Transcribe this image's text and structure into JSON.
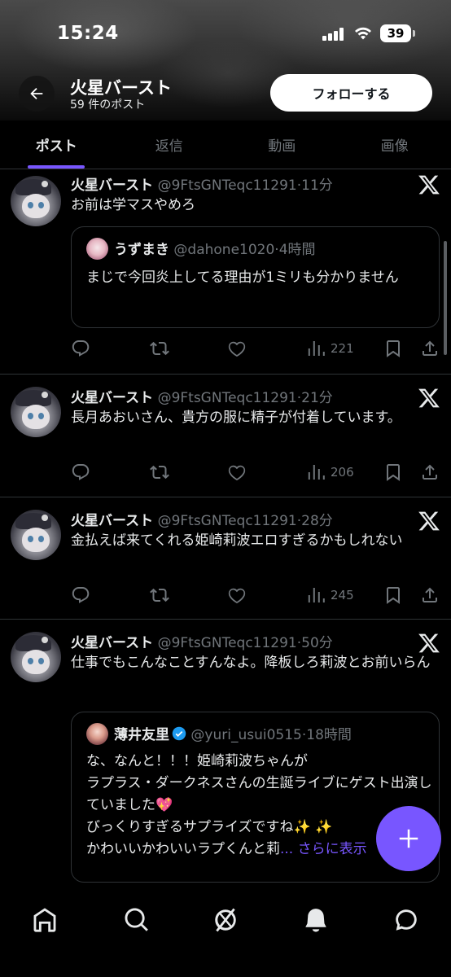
{
  "status_bar": {
    "time": "15:24",
    "battery": "39"
  },
  "header": {
    "profile_name": "火星バースト",
    "post_count": "59 件のポスト",
    "follow_label": "フォローする"
  },
  "tabs": [
    {
      "label": "ポスト",
      "active": true
    },
    {
      "label": "返信",
      "active": false
    },
    {
      "label": "動画",
      "active": false
    },
    {
      "label": "画像",
      "active": false
    }
  ],
  "posts": [
    {
      "author": "火星バースト",
      "handle": "@9FtsGNTeqc11291",
      "time": "11分",
      "text": "お前は学マスやめろ",
      "quote": {
        "author": "うずまき",
        "handle": "@dahone1020",
        "time": "4時間",
        "text": "まじで今回炎上してる理由が1ミリも分かりませ​ん"
      },
      "views": "221"
    },
    {
      "author": "火星バースト",
      "handle": "@9FtsGNTeqc11291",
      "time": "21分",
      "text": "長月あおいさん、貴方の服に精子が付着していま​す。",
      "views": "206"
    },
    {
      "author": "火星バースト",
      "handle": "@9FtsGNTeqc11291",
      "time": "28分",
      "text": "金払えば来てくれる姫崎莉波エロすぎるかもしれ​ない",
      "views": "245"
    },
    {
      "author": "火星バースト",
      "handle": "@9FtsGNTeqc11291",
      "time": "50分",
      "text": "仕事でもこんなことすんなよ。降板しろ莉波とお​前いらん",
      "quote": {
        "author": "薄井友里",
        "handle": "@yuri_usui0515",
        "time": "18時間",
        "line1": "な、なんと！！！姫崎莉波ちゃんが",
        "line2": "ラプラス・ダークネスさんの生誕ライブにゲスト出演していました💖",
        "line3": "びっくりすぎるサプライズですね✨ ✨",
        "line4": "かわいいかわいいラプくんと莉",
        "more": "... さらに表示"
      }
    }
  ],
  "icons": {
    "back": "arrow-left-icon",
    "reply": "reply-icon",
    "repost": "repost-icon",
    "like": "heart-icon",
    "views": "views-icon",
    "bookmark": "bookmark-icon",
    "share": "share-icon",
    "x": "x-logo-icon",
    "compose": "plus-icon",
    "nav": [
      "home-icon",
      "search-icon",
      "grok-icon",
      "bell-icon",
      "messages-icon"
    ]
  },
  "colors": {
    "accent": "#7856ff",
    "muted": "#71767b",
    "divider": "#2f3336",
    "verified": "#1d9bf0"
  }
}
